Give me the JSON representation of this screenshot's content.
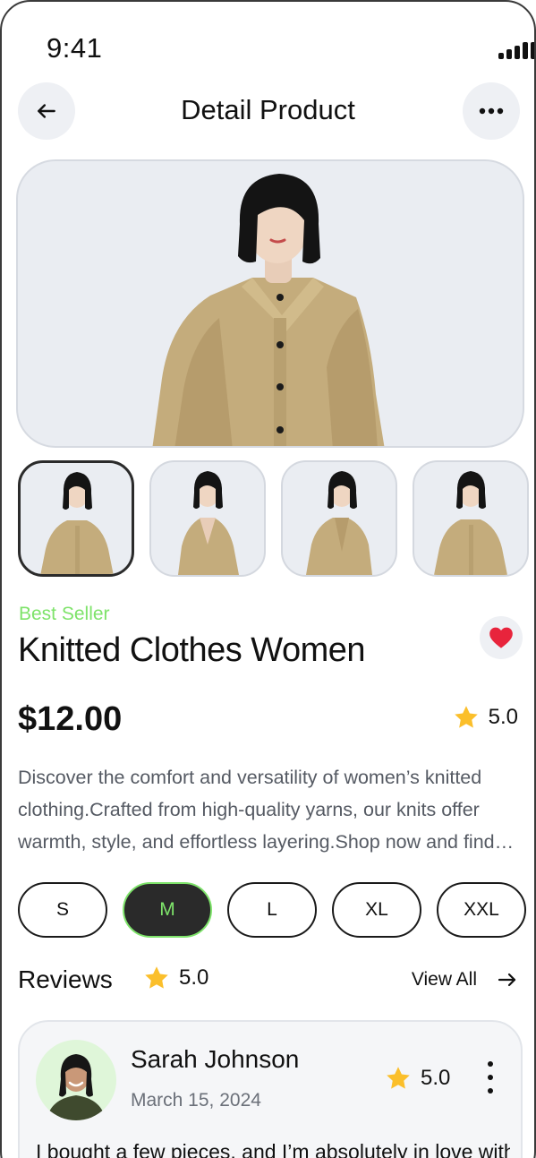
{
  "status_bar": {
    "time": "9:41"
  },
  "header": {
    "title": "Detail Product"
  },
  "product": {
    "badge": "Best Seller",
    "name": "Knitted Clothes Women",
    "price": "$12.00",
    "rating": "5.0",
    "description": "Discover the comfort and versatility of women’s knitted clothing.Crafted from high-quality yarns, our knits offer warmth, style, and effortless layering.Shop now and find your new favorite knit."
  },
  "sizes": [
    "S",
    "M",
    "L",
    "XL",
    "XXL"
  ],
  "selected_size": "M",
  "reviews": {
    "title": "Reviews",
    "rating": "5.0",
    "view_all_label": "View All",
    "items": [
      {
        "name": "Sarah Johnson",
        "date": "March 15, 2024",
        "rating": "5.0",
        "text": "I bought a few pieces, and I’m absolutely in love with them!"
      }
    ]
  },
  "colors": {
    "accent_green": "#7ee36a",
    "heart_red": "#e8243c",
    "star_yellow": "#fbbf2b",
    "dark": "#2a2a2a"
  },
  "icons": {
    "back": "arrow-left-icon",
    "more": "ellipsis-icon",
    "favorite": "heart-icon",
    "rating": "star-icon",
    "view_all": "arrow-right-icon",
    "review_menu": "kebab-icon"
  }
}
